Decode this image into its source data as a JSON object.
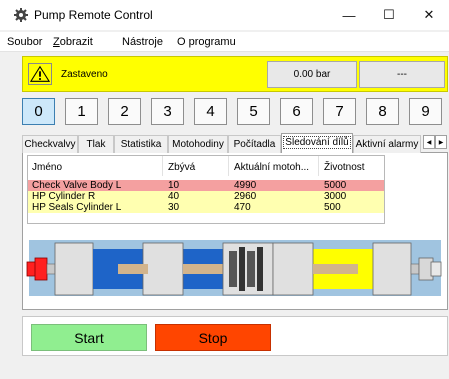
{
  "window": {
    "title": "Pump Remote Control",
    "minimize_glyph": "—",
    "maximize_glyph": "☐",
    "close_glyph": "✕"
  },
  "menu": [
    {
      "label": "Soubor"
    },
    {
      "label": "Zobrazit",
      "underline": "Z",
      "rest": "obrazit"
    },
    {
      "label": "Nástroje"
    },
    {
      "label": "O programu"
    }
  ],
  "status": {
    "text": "Zastaveno",
    "pressure": "0.00 bar",
    "extra": "---",
    "icon": "warning-icon",
    "color": "#ffff00"
  },
  "pump_selector": {
    "buttons": [
      "0",
      "1",
      "2",
      "3",
      "4",
      "5",
      "6",
      "7",
      "8",
      "9"
    ],
    "active": "0",
    "active_color": "#cde8fa"
  },
  "tabs": [
    {
      "label": "Checkvalvy"
    },
    {
      "label": "Tlak"
    },
    {
      "label": "Statistika"
    },
    {
      "label": "Motohodiny"
    },
    {
      "label": "Počítadla"
    },
    {
      "label": "Sledování dílů",
      "active": true
    },
    {
      "label": "Aktivní alarmy"
    }
  ],
  "tab_scroll": {
    "left": "◀",
    "right": "▶"
  },
  "parts_table": {
    "columns": [
      "Jméno",
      "Zbývá",
      "Aktuální motoh...",
      "Životnost"
    ],
    "rows": [
      {
        "name": "Check Valve Body L",
        "remaining": "10",
        "current_hours": "4990",
        "lifetime": "5000",
        "bg": "#f4a0a0"
      },
      {
        "name": "HP Cylinder R",
        "remaining": "40",
        "current_hours": "2960",
        "lifetime": "3000",
        "bg": "#ffffb0"
      },
      {
        "name": "HP Seals Cylinder L",
        "remaining": "30",
        "current_hours": "470",
        "lifetime": "500",
        "bg": "#ffffb0"
      }
    ]
  },
  "machine_colors": {
    "base": "#a0c4e0",
    "left_cylinder": "#1e64c8",
    "right_cylinder": "#ffff00",
    "left_valve": "#ff2020",
    "right_valve": "#c8c8c8"
  },
  "controls": {
    "start_label": "Start",
    "stop_label": "Stop",
    "start_color": "#90ee90",
    "stop_color": "#ff4500"
  }
}
